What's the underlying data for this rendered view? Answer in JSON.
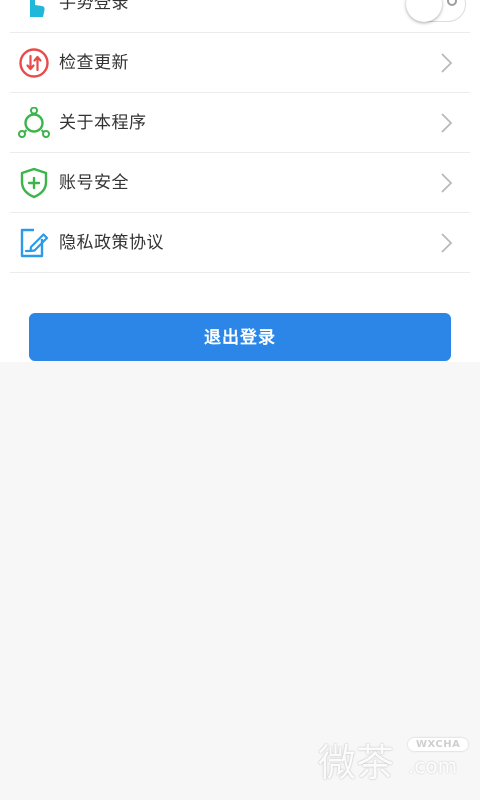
{
  "settings": {
    "gesture_login": {
      "label": "手势登录",
      "enabled": false
    },
    "items": [
      {
        "label": "检查更新",
        "icon": "update-icon",
        "color": "#e94b4b"
      },
      {
        "label": "关于本程序",
        "icon": "about-icon",
        "color": "#3cb44a"
      },
      {
        "label": "账号安全",
        "icon": "shield-plus-icon",
        "color": "#3cb44a"
      },
      {
        "label": "隐私政策协议",
        "icon": "edit-document-icon",
        "color": "#2b9be8"
      }
    ]
  },
  "logout_button": {
    "label": "退出登录",
    "color": "#2b86e8"
  },
  "watermark": {
    "text": "微茶",
    "badge": "WXCHA",
    "domain": ".com"
  }
}
